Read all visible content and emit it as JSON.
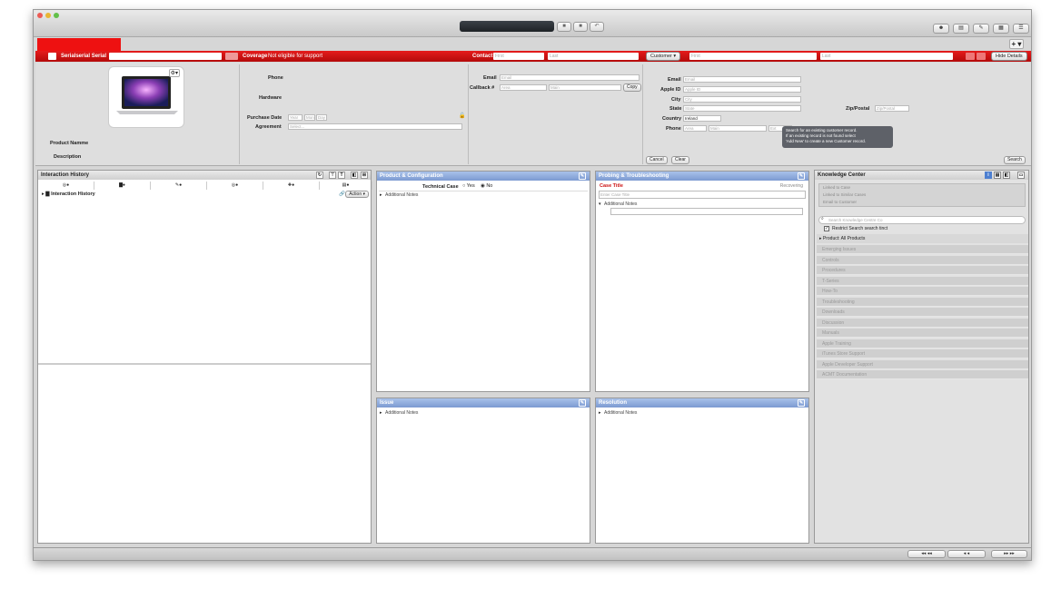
{
  "titlebar": {
    "window_buttons": [
      "close",
      "minimize",
      "zoom"
    ],
    "toolbar_buttons": [
      "stop-icon",
      "stop-icon",
      "undo-icon"
    ],
    "right_tools": [
      "people-icon",
      "cards-icon",
      "edit-icon",
      "calendar-icon",
      "list-icon"
    ],
    "plus_label": "+ ▾"
  },
  "redbar": {
    "serial_label": "Serialserial Serial",
    "coverage_label": "Coverage",
    "coverage_value": "Not eligible for support",
    "contact_label": "Contact",
    "first_placeholder": "First",
    "last_placeholder": "Last",
    "customer_btn": "Customer ▾",
    "first2_placeholder": "First",
    "last2_placeholder": "Last",
    "hide_details": "Hide Details"
  },
  "product": {
    "names_label": "Product Namme",
    "description_label": "Description",
    "phone_label": "Phone",
    "hardware_label": "Hardware",
    "purchase_label": "Purchase Date",
    "year_ph": "Year",
    "mon_ph": "Mon",
    "day_ph": "Day",
    "agreement_label": "Agreement",
    "agreement_value": "Select..."
  },
  "contact": {
    "email_label": "Email",
    "email_ph": "Email",
    "callback_label": "Callback #",
    "area_ph": "Area",
    "main_ph": "Main",
    "copy_btn": "Copy"
  },
  "customer": {
    "email_label": "Email",
    "email_ph": "Email",
    "appleid_label": "Apple ID",
    "appleid_ph": "Apple ID",
    "city_label": "City",
    "city_ph": "City",
    "state_label": "State",
    "state_ph": "State",
    "country_label": "Country",
    "country_value": "Ireland",
    "phone_label": "Phone",
    "area_ph": "Area",
    "main_ph": "Main",
    "ext_ph": "Ext",
    "zip_label": "Zip/Postal",
    "zip_ph": "Zip/Postal",
    "tooltip_lines": [
      "Search for an existing customer record.",
      "If an existing record is not found select",
      "'Add New' to create a new Customer record."
    ],
    "cancel_btn": "Cancel",
    "clear_btn": "Clear",
    "search_btn": "Search"
  },
  "history": {
    "title": "Interaction History",
    "row_text": "Interaction History",
    "action_btn": "Action ▾"
  },
  "product_config": {
    "title": "Product & Configuration",
    "tech_case_label": "Technical Case",
    "yes": "Yes",
    "no": "No",
    "notes": "Additional Notes"
  },
  "probing": {
    "title": "Probing & Troubleshooting",
    "case_title_label": "Case Title",
    "case_title_ph": "Enter Case Title",
    "right_label": "Recovering",
    "notes": "Additional Notes"
  },
  "issue": {
    "title": "Issue",
    "notes": "Additional Notes"
  },
  "resolution": {
    "title": "Resolution",
    "notes": "Additional Notes"
  },
  "knowledge": {
    "title": "Knowledge Center",
    "linked": [
      "Linked to Case",
      "Linked to Similar Cases",
      "Email to Customer"
    ],
    "search_ph": "Search Knowledge Centre Co",
    "restrict_label": "Restrict Search search tinct",
    "product_label": "Product: All Products",
    "categories": [
      "Emerging Issues",
      "Controls",
      "Procedures",
      "T-Series",
      "How-To",
      "Troubleshooting",
      "Downloads",
      "Discussion",
      "Manuals",
      "Apple Training",
      "iTunes Store Support",
      "Apple Developer Support",
      "ACMT Documentation"
    ]
  },
  "nav": {
    "buttons": [
      "◂◂  ◂◂",
      "◂  ◂",
      "▸  ▸",
      "▸▸ ▸▸"
    ]
  }
}
